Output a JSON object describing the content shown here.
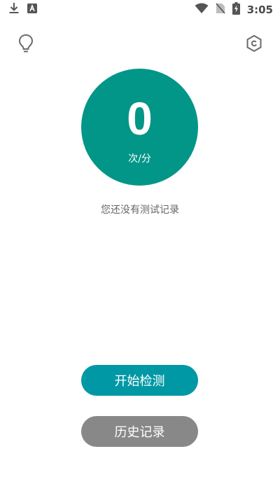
{
  "status_bar": {
    "time": "3:05",
    "left_icons": [
      "download-icon",
      "app-notification-icon"
    ],
    "right_icons": [
      "wifi-icon",
      "no-sim-icon",
      "battery-charging-icon"
    ]
  },
  "header": {
    "left_icon": "lightbulb-icon",
    "right_icon": "settings-hexagon-icon"
  },
  "meter": {
    "value": "0",
    "unit": "次/分",
    "color": "#019687"
  },
  "empty_message": "您还没有测试记录",
  "buttons": {
    "start_label": "开始检测",
    "start_color": "#0098a5",
    "history_label": "历史记录",
    "history_color": "#888888"
  }
}
